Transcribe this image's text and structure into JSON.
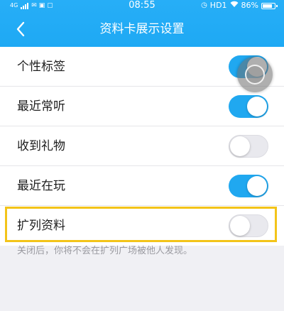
{
  "status_bar": {
    "network": "4G",
    "time": "08:55",
    "network_right": "HD1",
    "battery": "86%",
    "battery_level": 0.86
  },
  "nav": {
    "title": "资料卡展示设置",
    "back_icon": "chevron-left-icon"
  },
  "settings": [
    {
      "label": "个性标签",
      "enabled": true
    },
    {
      "label": "最近常听",
      "enabled": true
    },
    {
      "label": "收到礼物",
      "enabled": false
    },
    {
      "label": "最近在玩",
      "enabled": true
    },
    {
      "label": "扩列资料",
      "enabled": false
    }
  ],
  "note": "关闭后，你将不会在扩列广场被他人发现。",
  "colors": {
    "header": "#1ea9f4",
    "toggle_on": "#20a8f0",
    "toggle_off": "#e9e9ee",
    "highlight": "#f3c419",
    "background": "#f0f0f4"
  }
}
